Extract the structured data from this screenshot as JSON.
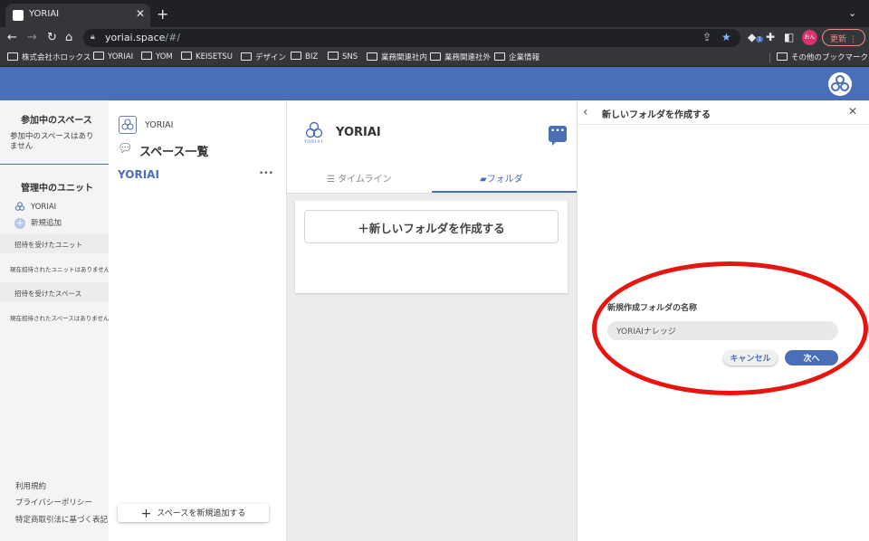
{
  "browser": {
    "tab_title": "YORIAI",
    "tab_close": "✕",
    "new_tab": "+",
    "url_host": "yoriai.space",
    "url_path": "/#/",
    "profile_initials": "おん",
    "update_label": "更新",
    "extension_badge": "1",
    "bookmarks": [
      "株式会社ホロックス",
      "YORIAI",
      "YOM",
      "KEISETSU",
      "デザイン",
      "BIZ",
      "SNS",
      "業務関連社内",
      "業務関連社外",
      "企業情報"
    ],
    "other_bookmarks": "その他のブックマーク"
  },
  "sidebar": {
    "joined_heading": "参加中のスペース",
    "joined_empty": "参加中のスペースはありません",
    "managed_heading": "管理中のユニット",
    "unit_name": "YORIAI",
    "add_new": "新規追加",
    "invited_units_heading": "招待を受けたユニット",
    "invited_units_empty": "現在招待されたユニットはありません。",
    "invited_spaces_heading": "招待を受けたスペース",
    "invited_spaces_empty": "現在招待されたスペースはありません。",
    "footer": [
      "利用規約",
      "プライバシーポリシー",
      "特定商取引法に基づく表記"
    ]
  },
  "spaces": {
    "unit_label": "YORIAI",
    "title": "スペース一覧",
    "selected_space": "YORIAI",
    "more": "•••",
    "add_button": "スペースを新規追加する"
  },
  "main": {
    "space_name": "YORIAI",
    "logo_text": "YORIAI",
    "tabs": [
      {
        "label": "タイムライン",
        "active": false
      },
      {
        "label": "フォルダ",
        "active": true
      }
    ],
    "new_folder_button": "＋新しいフォルダを作成する"
  },
  "panel": {
    "title": "新しいフォルダを作成する",
    "field_label": "新規作成フォルダの名称",
    "field_value": "YORIAIナレッジ",
    "cancel_label": "キャンセル",
    "next_label": "次へ"
  },
  "colors": {
    "brand_blue": "#4a6fb8",
    "highlight_red": "#e8140f"
  }
}
